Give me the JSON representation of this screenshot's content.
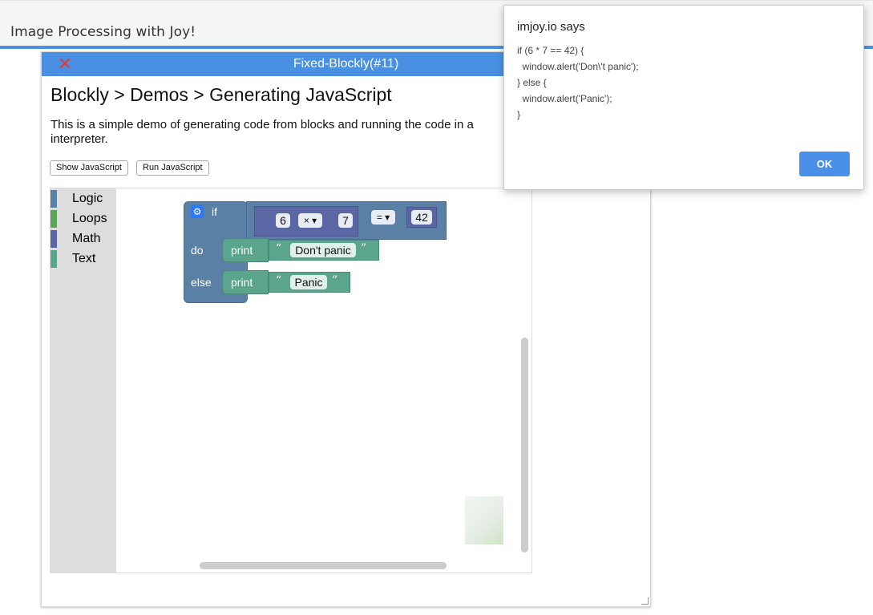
{
  "app": {
    "title": "Image Processing with Joy!"
  },
  "window": {
    "title": "Fixed-Blockly(#11)",
    "close_icon": "✕"
  },
  "doc": {
    "heading": "Blockly > Demos > Generating JavaScript",
    "description": "This is a simple demo of generating code from blocks and running the code in a interpreter.",
    "show_js_label": "Show JavaScript",
    "run_js_label": "Run JavaScript"
  },
  "toolbox": {
    "categories": [
      {
        "label": "Logic",
        "color": "#5b80a5"
      },
      {
        "label": "Loops",
        "color": "#5ba55b"
      },
      {
        "label": "Math",
        "color": "#5b67a5"
      },
      {
        "label": "Text",
        "color": "#5ba58c"
      }
    ]
  },
  "blocks": {
    "if_keyword": "if",
    "do_keyword": "do",
    "else_keyword": "else",
    "left_operand": "6",
    "operator": "× ▾",
    "right_operand": "7",
    "compare_operator": "= ▾",
    "compare_value": "42",
    "print_keyword": "print",
    "open_quote": "“",
    "close_quote": "”",
    "do_text": "Don't panic",
    "else_text": "Panic"
  },
  "alert": {
    "title": "imjoy.io says",
    "code": "if (6 * 7 == 42) {\n  window.alert('Don\\'t panic');\n} else {\n  window.alert('Panic');\n}",
    "ok_label": "OK"
  }
}
